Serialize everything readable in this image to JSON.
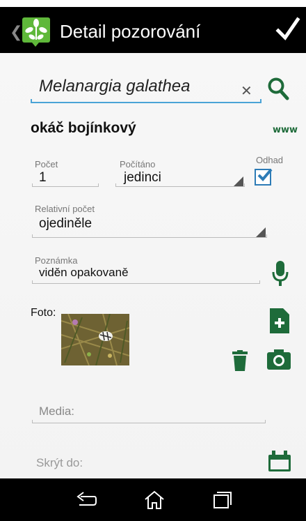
{
  "action_bar": {
    "title": "Detail pozorování",
    "app_icon": "leaf-app-icon",
    "confirm_icon": "check-icon",
    "back_icon": "chevron-left-icon"
  },
  "form": {
    "species_input": {
      "value": "Melanargia galathea",
      "clear_icon": "close-icon",
      "search_icon": "search-icon"
    },
    "common_name": "okáč bojínkový",
    "www_link": "www",
    "count": {
      "label": "Počet",
      "value": "1"
    },
    "counted": {
      "label": "Počítáno",
      "value": "jedinci"
    },
    "estimate": {
      "label": "Odhad",
      "checked": true
    },
    "relative_count": {
      "label": "Relativní počet",
      "value": "ojediněle"
    },
    "note": {
      "label": "Poznámka",
      "value": "viděn opakovaně",
      "mic_icon": "microphone-icon"
    },
    "photo": {
      "label": "Foto:",
      "add_icon": "file-add-icon",
      "delete_icon": "trash-icon",
      "camera_icon": "camera-icon"
    },
    "media": {
      "placeholder": "Media:"
    },
    "hide_until": {
      "label": "Skrýt do:",
      "calendar_icon": "calendar-icon"
    }
  },
  "nav_bar": {
    "back_icon": "back-arrow-icon",
    "home_icon": "home-icon",
    "recents_icon": "recents-icon"
  },
  "colors": {
    "accent_green": "#1e6b3a",
    "focus_blue": "#4aa3d6",
    "bar_black": "#000000"
  }
}
